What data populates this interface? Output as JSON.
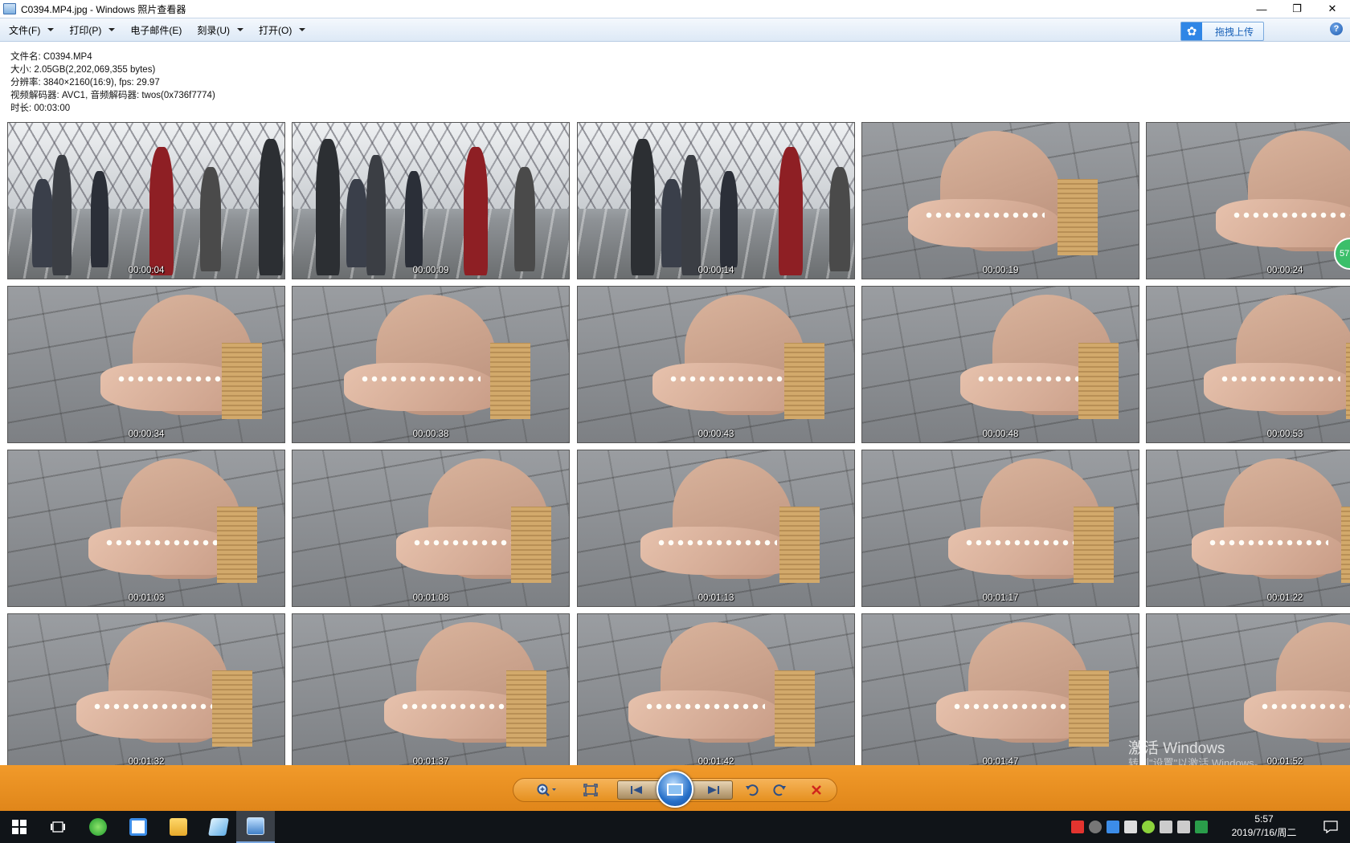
{
  "window": {
    "title": "C0394.MP4.jpg - Windows 照片查看器",
    "minimize": "—",
    "restore": "❐",
    "close": "✕"
  },
  "menu": {
    "file": "文件(F)",
    "print": "打印(P)",
    "email": "电子邮件(E)",
    "burn": "刻录(U)",
    "open": "打开(O)",
    "upload": "拖拽上传",
    "help": "?"
  },
  "info": {
    "filename": "文件名: C0394.MP4",
    "size": "大小: 2.05GB(2,202,069,355 bytes)",
    "resolution": "分辨率: 3840×2160(16:9), fps: 29.97",
    "codec": "视频解码器: AVC1, 音频解码器: twos(0x736f7774)",
    "duration": "时长: 00:03:00"
  },
  "thumbnails": [
    {
      "time": "00:00:04",
      "scene": "platform"
    },
    {
      "time": "00:00:09",
      "scene": "platform"
    },
    {
      "time": "00:00:14",
      "scene": "platform"
    },
    {
      "time": "00:00:19",
      "scene": "floor"
    },
    {
      "time": "00:00:24",
      "scene": "floor"
    },
    {
      "time": "00:00:34",
      "scene": "floor"
    },
    {
      "time": "00:00:38",
      "scene": "floor"
    },
    {
      "time": "00:00:43",
      "scene": "floor"
    },
    {
      "time": "00:00:48",
      "scene": "floor"
    },
    {
      "time": "00:00:53",
      "scene": "floor"
    },
    {
      "time": "00:01:03",
      "scene": "floor"
    },
    {
      "time": "00:01:08",
      "scene": "floor"
    },
    {
      "time": "00:01:13",
      "scene": "floor"
    },
    {
      "time": "00:01:17",
      "scene": "floor"
    },
    {
      "time": "00:01:22",
      "scene": "floor"
    },
    {
      "time": "00:01:32",
      "scene": "floor"
    },
    {
      "time": "00:01:37",
      "scene": "floor"
    },
    {
      "time": "00:01:42",
      "scene": "floor"
    },
    {
      "time": "00:01:47",
      "scene": "floor"
    },
    {
      "time": "00:01:52",
      "scene": "floor"
    }
  ],
  "watermark": {
    "line1": "激活 Windows",
    "line2": "转到\"设置\"以激活 Windows。"
  },
  "side_badge": "57",
  "controls": {
    "zoom_icon": "magnifier-zoom-icon",
    "actual_size_icon": "fit-window-icon",
    "prev_icon": "previous-icon",
    "slideshow_icon": "slideshow-icon",
    "next_icon": "next-icon",
    "rotate_ccw_icon": "rotate-left-icon",
    "rotate_cw_icon": "rotate-right-icon",
    "delete_icon": "delete-icon"
  },
  "taskbar": {
    "time": "5:57",
    "date": "2019/7/16/周二"
  },
  "colors": {
    "control_bar": "#e58c1e",
    "taskbar": "#101418",
    "menubar": "#dde9f6"
  }
}
